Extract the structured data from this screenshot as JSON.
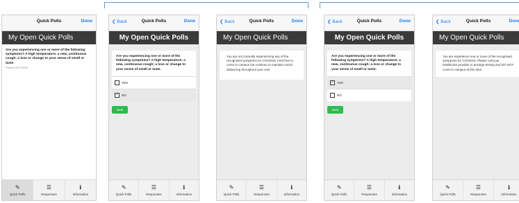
{
  "nav": {
    "back": "Back",
    "title": "Quick Polls",
    "done": "Done"
  },
  "header": "My Open Quick Polls",
  "question": "Are you experiencing one or more of the following symptoms? A high temperature; a new, continuous cough; a loss or change to your sense of smell or taste.",
  "posted": "Posted 13/07/2020",
  "options": {
    "yes": "YES",
    "no": "NO"
  },
  "next_label": "Next",
  "messages": {
    "no_symptoms": "You are not currently experiencing any of the recognised symptoms for COVID19. Feel free to come to campus but continue to maintain social distancing throughout your visit",
    "has_symptoms": "You are experience one or more of the recognised symptoms for COVID19. Please call your healthcare provider to arrange testing and DO NOT come to campus at this time."
  },
  "tabs": {
    "quick_polls": "Quick Polls",
    "responses": "Responses",
    "information": "Information"
  },
  "icons": {
    "back": "chevron-left-icon",
    "quick_polls": "edit-icon",
    "responses": "list-icon",
    "information": "info-icon"
  },
  "colors": {
    "accent": "#1a7cf5",
    "header_bg": "#3a3a3a",
    "next_button": "#2dbb4e",
    "bracket": "#5b9bd5"
  }
}
